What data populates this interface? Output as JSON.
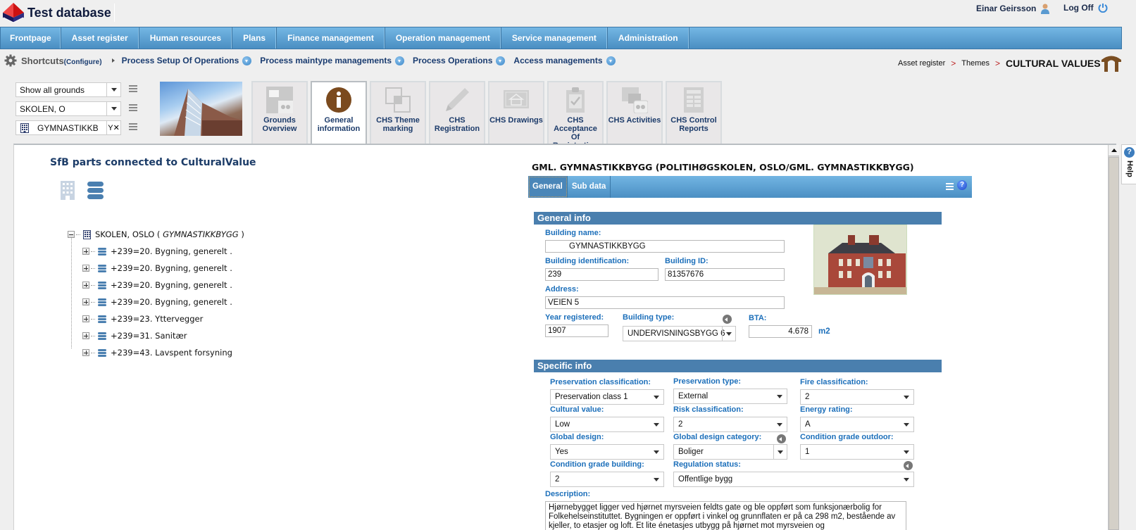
{
  "app": {
    "title": "Test database",
    "user_name": "Einar Geirsson",
    "logoff_label": "Log Off"
  },
  "main_nav": [
    {
      "label": "Frontpage"
    },
    {
      "label": "Asset register"
    },
    {
      "label": "Human resources"
    },
    {
      "label": "Plans"
    },
    {
      "label": "Finance management"
    },
    {
      "label": "Operation management"
    },
    {
      "label": "Service management"
    },
    {
      "label": "Administration"
    }
  ],
  "shortcuts": {
    "label": "Shortcuts",
    "configure_label": "(Configure)",
    "items": [
      {
        "label": "Process Setup Of Operations"
      },
      {
        "label": "Process maintype managements"
      },
      {
        "label": "Process Operations"
      },
      {
        "label": "Access managements"
      }
    ]
  },
  "breadcrumb": {
    "items": [
      "Asset register",
      "Themes"
    ],
    "separator": ">",
    "current": "CULTURAL VALUES"
  },
  "selectors": {
    "grounds": "Show all grounds",
    "property": "SKOLEN, O",
    "building": "GYMNASTIKKB",
    "building_suffix": "Y"
  },
  "tabs": [
    {
      "label": "Grounds Overview",
      "icon": "grounds-overview-icon",
      "active": false
    },
    {
      "label": "General information",
      "icon": "info-icon",
      "active": true
    },
    {
      "label": "CHS Theme marking",
      "icon": "theme-marking-icon",
      "active": false
    },
    {
      "label": "CHS Registration",
      "icon": "pencil-icon",
      "active": false
    },
    {
      "label": "CHS Drawings",
      "icon": "drawing-icon",
      "active": false
    },
    {
      "label": "CHS Acceptance Of Registration",
      "icon": "clipboard-check-icon",
      "active": false
    },
    {
      "label": "CHS Activities",
      "icon": "activities-icon",
      "active": false
    },
    {
      "label": "CHS Control Reports",
      "icon": "report-icon",
      "active": false
    }
  ],
  "left_panel": {
    "title": "SfB parts connected to CulturalValue",
    "tree": {
      "root_label": "SKOLEN, OSLO (",
      "root_italic": "GYMNASTIKKBYGG",
      "root_close": ")",
      "children": [
        "+239=20. Bygning, generelt .",
        "+239=20. Bygning, generelt .",
        "+239=20. Bygning, generelt .",
        "+239=20. Bygning, generelt .",
        "+239=23. Yttervegger",
        "+239=31. Sanitær",
        "+239=43. Lavspent forsyning"
      ]
    }
  },
  "right_panel": {
    "title": "GML. GYMNASTIKKBYGG (POLITIHØGSKOLEN, OSLO/GML. GYMNASTIKKBYGG)",
    "subtabs": [
      {
        "label": "General",
        "active": true
      },
      {
        "label": "Sub data",
        "active": false
      }
    ],
    "general_info": {
      "heading": "General info",
      "building_name_label": "Building name:",
      "building_name": "GYMNASTIKKBYGG",
      "building_identification_label": "Building identification:",
      "building_identification": "239",
      "building_id_label": "Building ID:",
      "building_id": "81357676",
      "address_label": "Address:",
      "address": "VEIEN 5",
      "year_registered_label": "Year registered:",
      "year_registered": "1907",
      "building_type_label": "Building type:",
      "building_type": "UNDERVISNINGSBYGG 6",
      "bta_label": "BTA:",
      "bta": "4.678",
      "bta_unit": "m2"
    },
    "specific_info": {
      "heading": "Specific info",
      "preservation_classification_label": "Preservation classification:",
      "preservation_classification": "Preservation class 1",
      "preservation_type_label": "Preservation type:",
      "preservation_type": "External",
      "fire_classification_label": "Fire classification:",
      "fire_classification": "2",
      "cultural_value_label": "Cultural value:",
      "cultural_value": "Low",
      "risk_classification_label": "Risk classification:",
      "risk_classification": "2",
      "energy_rating_label": "Energy rating:",
      "energy_rating": "A",
      "global_design_label": "Global design:",
      "global_design": "Yes",
      "global_design_category_label": "Global design category:",
      "global_design_category": "Boliger",
      "condition_grade_outdoor_label": "Condition grade outdoor:",
      "condition_grade_outdoor": "1",
      "condition_grade_building_label": "Condition grade building:",
      "condition_grade_building": "2",
      "regulation_status_label": "Regulation status:",
      "regulation_status": "Offentlige bygg",
      "description_label": "Description:",
      "description": "Hjørnebygget ligger ved hjørnet        myrsveien              feldts gate og ble oppført som funksjonærbolig for Folkehelseinstituttet. Bygningen er oppført i vinkel og grunnflaten er på ca 298 m2, bestående av kjeller, to etasjer og loft. Et lite énetasjes utbygg på hjørnet mot        myrsveien og"
    }
  },
  "help": {
    "label": "Help"
  }
}
